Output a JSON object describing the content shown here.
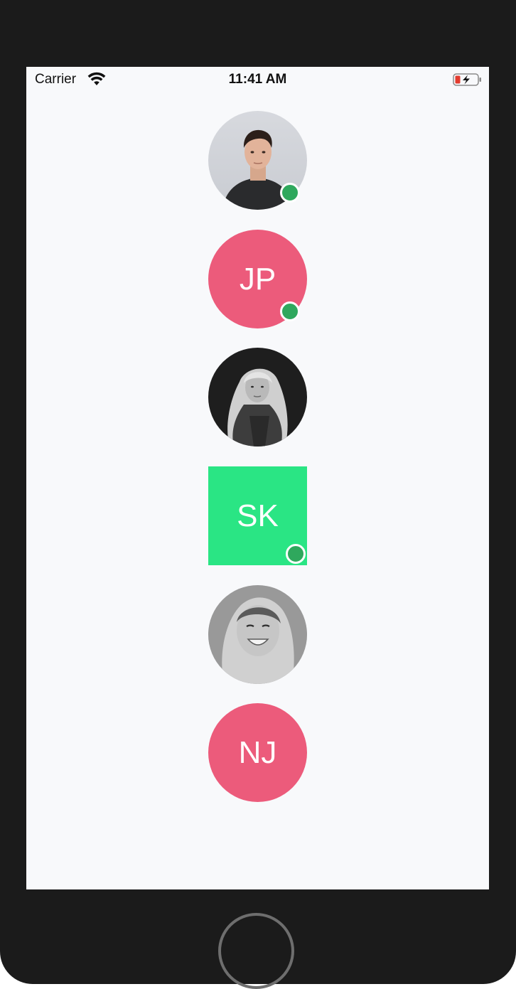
{
  "status_bar": {
    "carrier": "Carrier",
    "time": "11:41 AM",
    "wifi_icon": "wifi-icon",
    "battery_icon": "battery-charging-icon"
  },
  "avatars": [
    {
      "kind": "image",
      "subject": "man-portrait",
      "shape": "circle",
      "online": true
    },
    {
      "kind": "initials",
      "initials": "JP",
      "shape": "circle",
      "color": "#ec5b7b",
      "online": true
    },
    {
      "kind": "image",
      "subject": "woman-portrait-bw",
      "shape": "circle",
      "online": false
    },
    {
      "kind": "initials",
      "initials": "SK",
      "shape": "square",
      "color": "#2ae584",
      "online": true
    },
    {
      "kind": "image",
      "subject": "smiling-woman-bw",
      "shape": "circle",
      "online": false
    },
    {
      "kind": "initials",
      "initials": "NJ",
      "shape": "circle",
      "color": "#ec5b7b",
      "online": false
    }
  ],
  "colors": {
    "presence_online": "#2fa85d",
    "background": "#f8f9fb"
  }
}
